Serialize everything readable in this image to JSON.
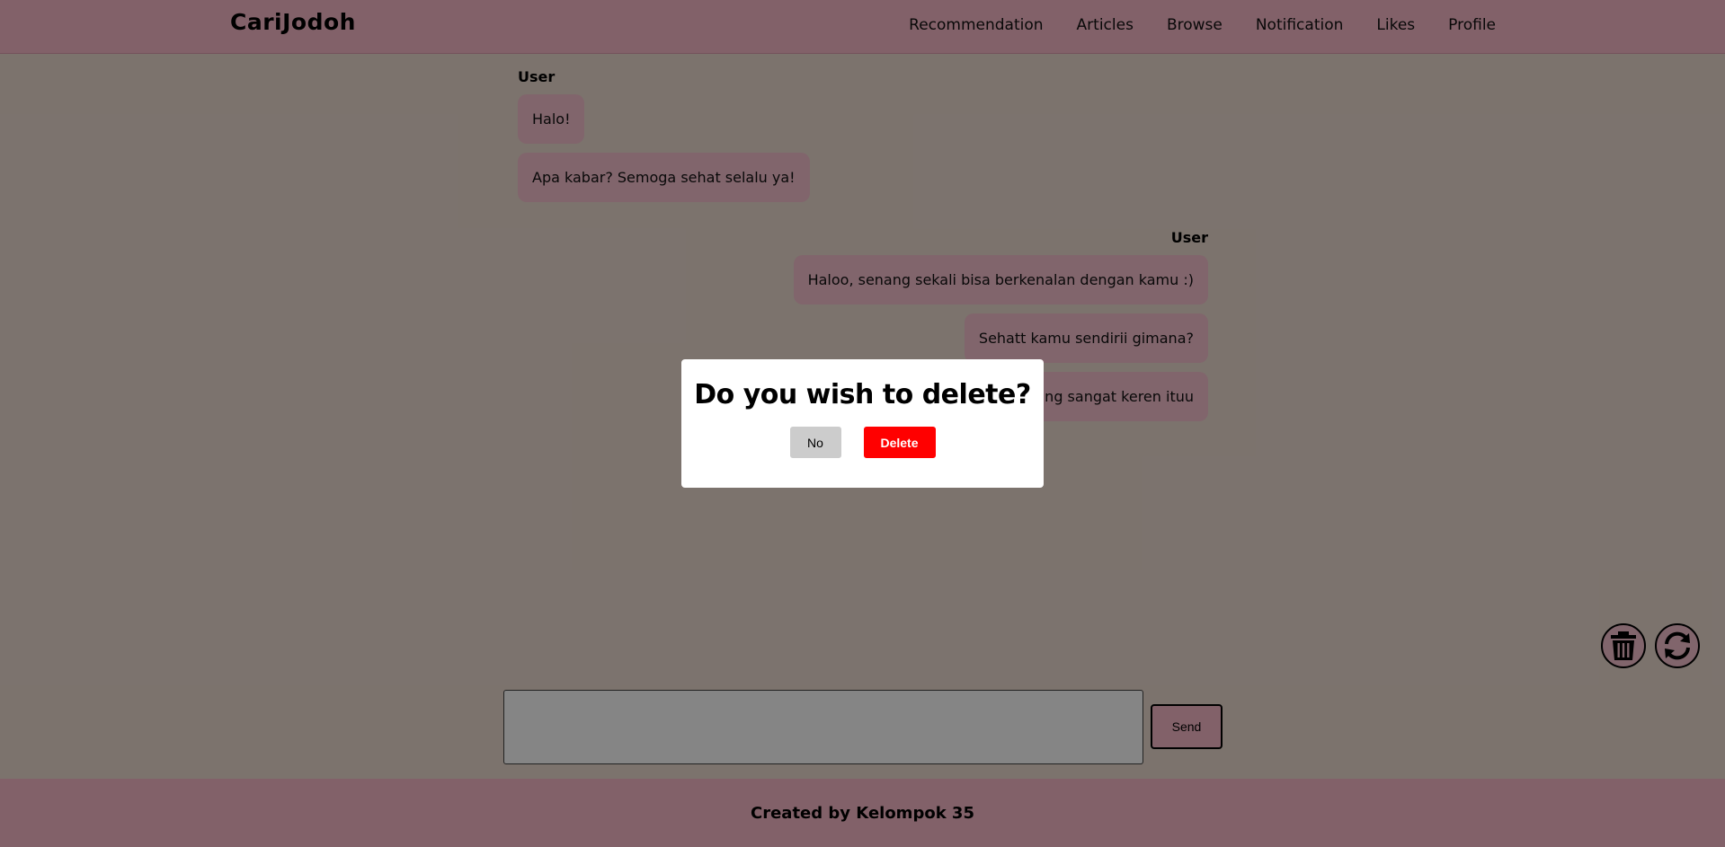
{
  "header": {
    "brand": "CariJodoh",
    "nav": [
      "Recommendation",
      "Articles",
      "Browse",
      "Notification",
      "Likes",
      "Profile"
    ]
  },
  "chat": {
    "groups": [
      {
        "sender": "User",
        "side": "left",
        "messages": [
          "Halo!",
          "Apa kabar? Semoga sehat selalu ya!"
        ]
      },
      {
        "sender": "User",
        "side": "right",
        "messages": [
          "Haloo, senang sekali bisa berkenalan dengan kamu :)",
          "Sehatt kamu sendirii gimana?",
          "ng sangat keren ituu"
        ]
      }
    ]
  },
  "dialog": {
    "title": "Do you wish to delete?",
    "no_label": "No",
    "delete_label": "Delete"
  },
  "composer": {
    "send_label": "Send"
  },
  "icons": {
    "delete_chat": "trash-icon",
    "refresh_chat": "refresh-icon"
  },
  "footer": {
    "text": "Created by Kelompok 35"
  },
  "colors": {
    "accent_pink": "#f9bac9",
    "bubble_pink": "#f7c1cf",
    "background": "#eddcd2",
    "delete_red": "#ff0000",
    "no_gray": "#cccccc"
  }
}
